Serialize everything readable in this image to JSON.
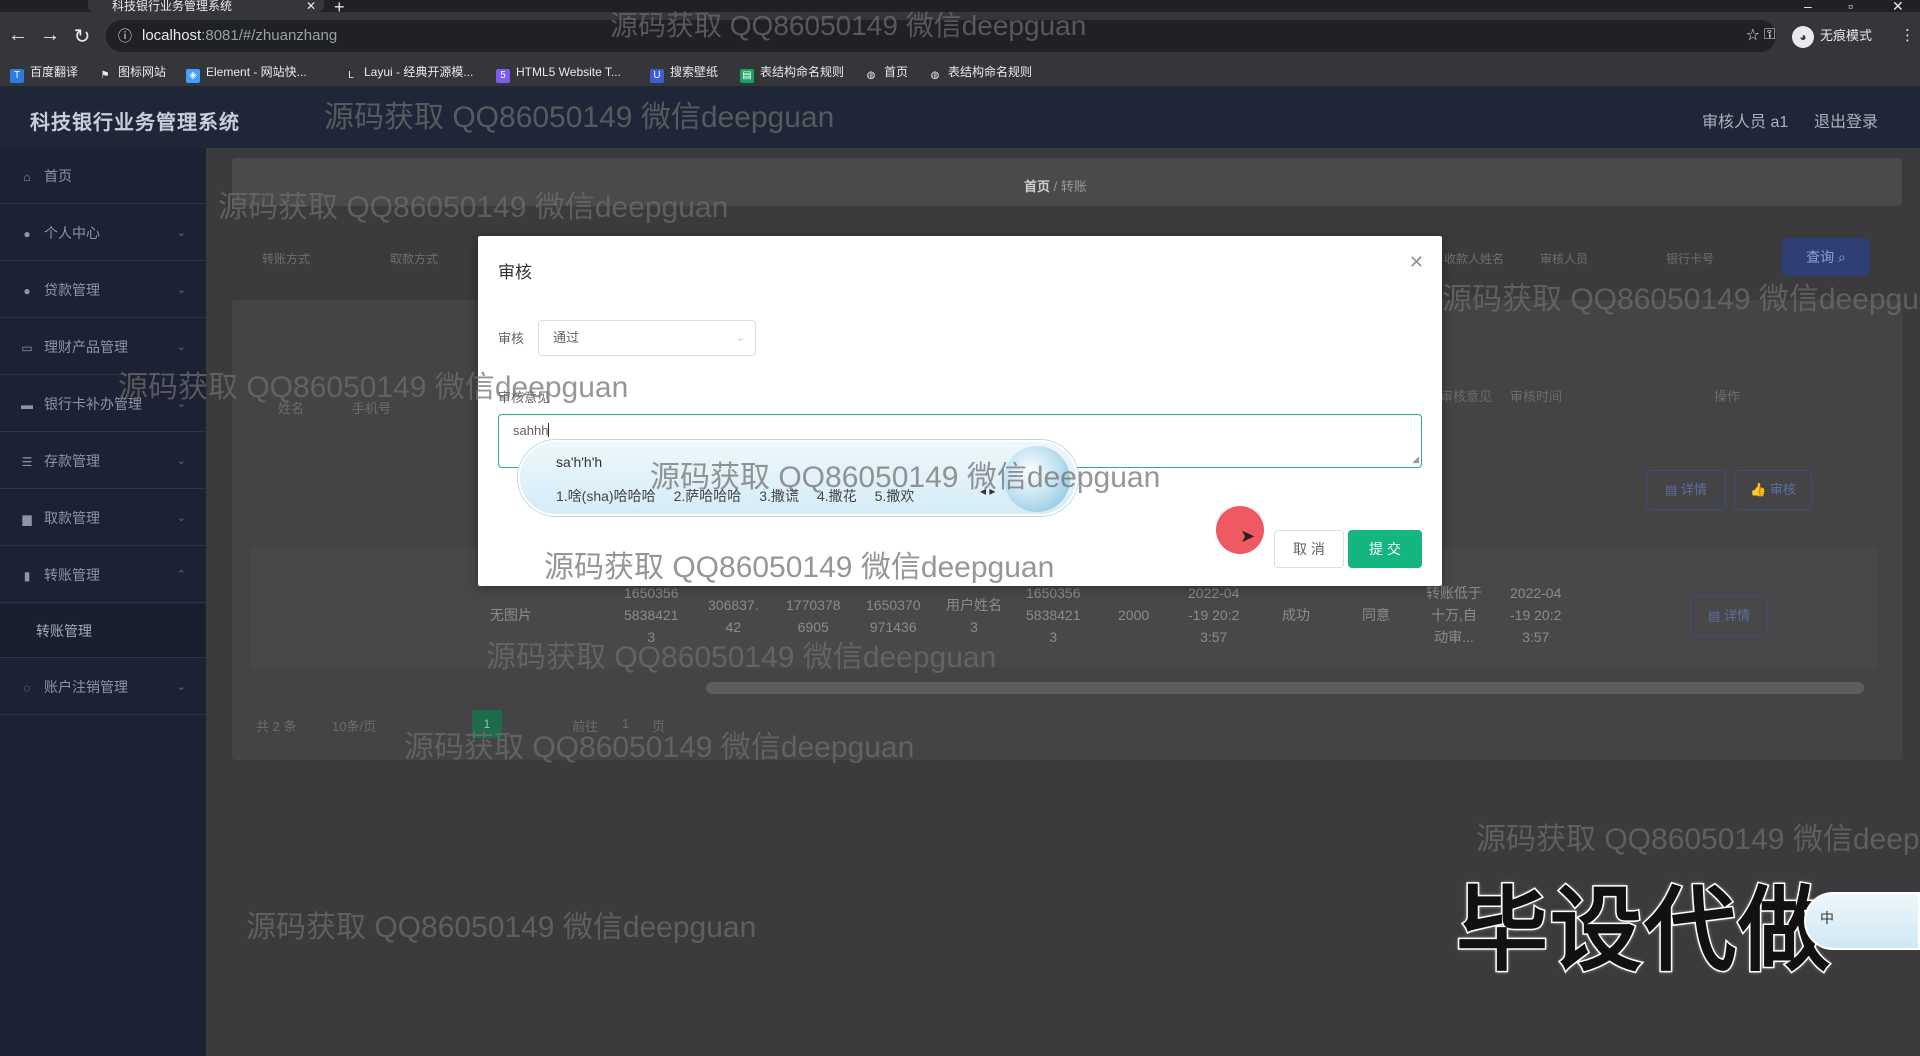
{
  "browser": {
    "tab_title": "科技银行业务管理系统",
    "url_host": "localhost",
    "url_path": ":8081/#/zhuanzhang",
    "incognito_label": "无痕模式",
    "bookmarks": [
      "百度翻译",
      "图标网站",
      "Element - 网站快...",
      "Layui - 经典开源模...",
      "HTML5 Website T...",
      "搜索壁纸",
      "表结构命名规则",
      "首页",
      "表结构命名规则"
    ]
  },
  "header": {
    "title": "科技银行业务管理系统",
    "user": "审核人员 a1",
    "logout": "退出登录"
  },
  "sidebar": {
    "items": [
      {
        "label": "首页"
      },
      {
        "label": "个人中心"
      },
      {
        "label": "贷款管理"
      },
      {
        "label": "理财产品管理"
      },
      {
        "label": "银行卡补办管理"
      },
      {
        "label": "存款管理"
      },
      {
        "label": "取款管理"
      },
      {
        "label": "转账管理"
      },
      {
        "label": "转账管理"
      },
      {
        "label": "账户注销管理"
      }
    ]
  },
  "main": {
    "breadcrumb_home": "首页",
    "breadcrumb_current": "转账",
    "search_fields": [
      "转账方式",
      "取款方式",
      "收款人姓名",
      "审核人员",
      "银行卡号"
    ],
    "query_label": "查询",
    "columns": [
      "姓名",
      "手机号",
      "审核意见",
      "审核时间",
      "操作"
    ],
    "row": {
      "image": "无图片",
      "account": "1650356\n5838421\n3",
      "amount_a": "306837.\n42",
      "code": "1770378\n6905",
      "phone": "1650370\n971436",
      "name": "用户姓名\n3",
      "card": "1650356\n5838421\n3",
      "amount": "2000",
      "time": "2022-04\n-19 20:2\n3:57",
      "status": "成功",
      "review": "同意",
      "remark": "转账低于\n十万,自\n动审...",
      "review_time": "2022-04\n-19 20:2\n3:57"
    },
    "detail_label": "详情",
    "audit_label": "审核",
    "pager_total": "共 2 条",
    "pager_size": "10条/页",
    "pager_page": "1",
    "pager_goto": "前往",
    "pager_goto_value": "1",
    "pager_unit": "页"
  },
  "dialog": {
    "title": "审核",
    "status_label": "审核",
    "status_value": "通过",
    "opinion_label": "审核意见",
    "opinion_value": "sahhh",
    "cancel": "取 消",
    "submit": "提 交"
  },
  "ime": {
    "pinyin": "sa'h'h'h",
    "candidates": [
      "1.啥(sha)哈哈哈",
      "2.萨哈哈哈",
      "3.撒谎",
      "4.撒花",
      "5.撒欢"
    ],
    "mini": "中"
  },
  "watermark": "源码获取 QQ86050149 微信deepguan",
  "caption": "毕设代做"
}
